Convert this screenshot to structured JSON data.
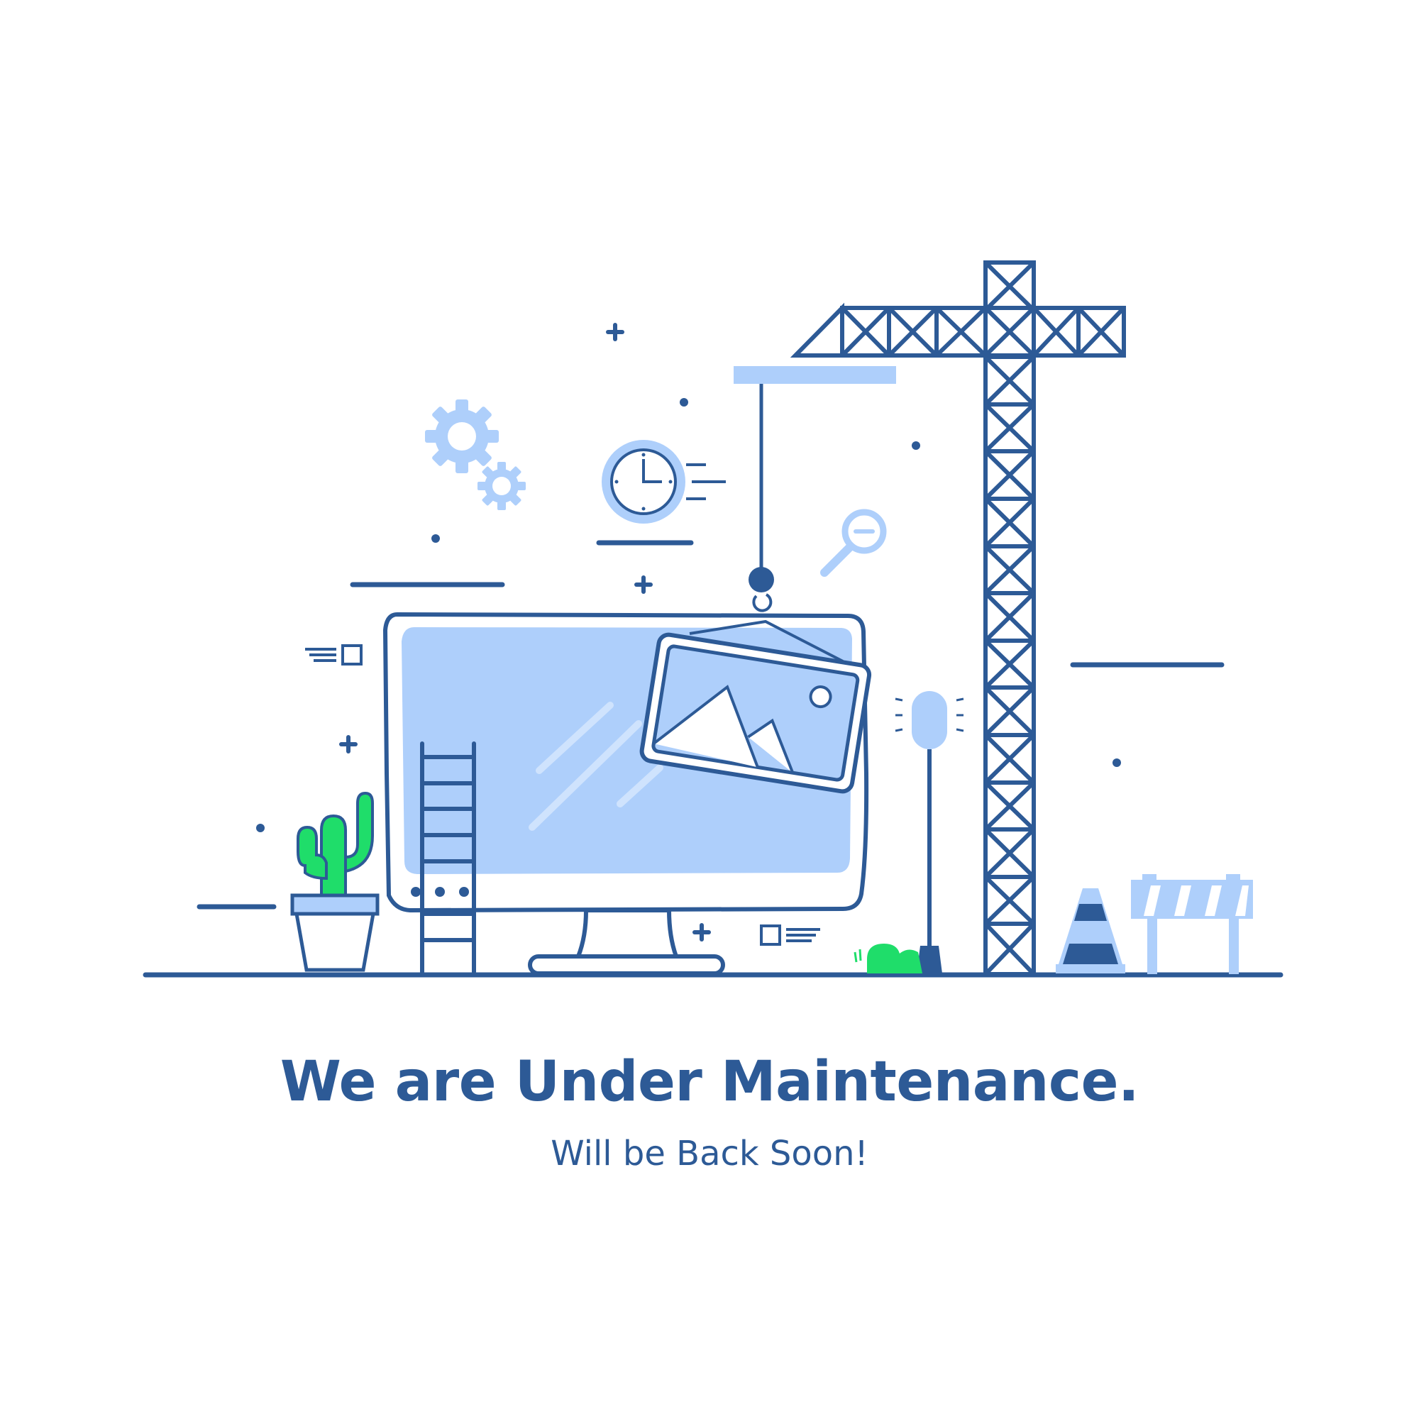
{
  "message": {
    "title": "We are Under Maintenance.",
    "subtitle": "Will be Back Soon!"
  },
  "colors": {
    "primary": "#2d5a96",
    "light_blue": "#aecffb",
    "green": "#1fdd6a",
    "background": "#ffffff"
  },
  "illustration": {
    "elements": [
      "monitor-icon",
      "crane-icon",
      "picture-frame-icon",
      "ladder-icon",
      "cactus-icon",
      "gear-icon",
      "clock-icon",
      "magnifier-icon",
      "traffic-cone-icon",
      "road-barrier-icon",
      "street-lamp-icon",
      "bush-icon"
    ]
  }
}
